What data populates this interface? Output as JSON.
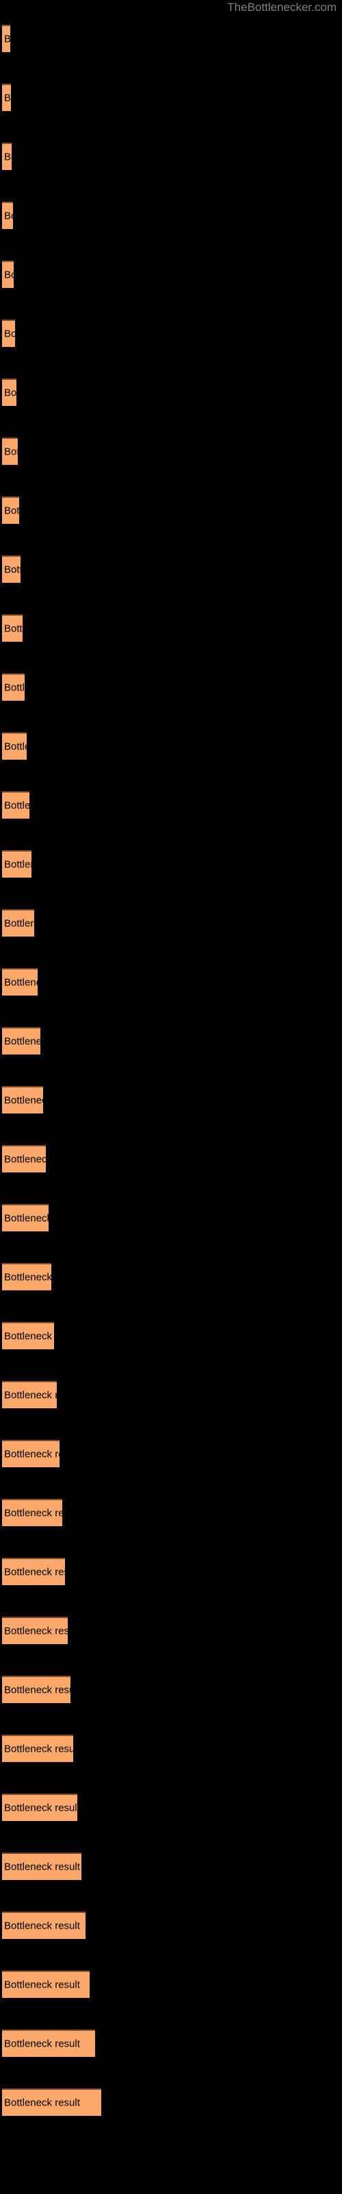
{
  "header": {
    "site_title": "TheBottlenecker.com"
  },
  "colors": {
    "background": "#000000",
    "bar_fill": "#FCA96B",
    "bar_edge": "#7a4a22",
    "bar_label_text": "#000000",
    "site_title_text": "#808080"
  },
  "chart_data": {
    "type": "bar",
    "orientation": "horizontal",
    "title": "TheBottlenecker.com",
    "xlabel": "",
    "ylabel": "",
    "grid": false,
    "legend": false,
    "xlim": [
      0,
      500
    ],
    "bar_label": "Bottleneck result",
    "categories": [
      "Bottleneck result",
      "Bottleneck result",
      "Bottleneck result",
      "Bottleneck result",
      "Bottleneck result",
      "Bottleneck result",
      "Bottleneck result",
      "Bottleneck result",
      "Bottleneck result",
      "Bottleneck result",
      "Bottleneck result",
      "Bottleneck result",
      "Bottleneck result",
      "Bottleneck result",
      "Bottleneck result",
      "Bottleneck result",
      "Bottleneck result",
      "Bottleneck result",
      "Bottleneck result",
      "Bottleneck result",
      "Bottleneck result",
      "Bottleneck result",
      "Bottleneck result",
      "Bottleneck result",
      "Bottleneck result",
      "Bottleneck result",
      "Bottleneck result",
      "Bottleneck result",
      "Bottleneck result",
      "Bottleneck result",
      "Bottleneck result",
      "Bottleneck result",
      "Bottleneck result",
      "Bottleneck result",
      "Bottleneck result",
      "Bottleneck result"
    ],
    "values": [
      12,
      13,
      14,
      16,
      17,
      19,
      21,
      23,
      25,
      27,
      30,
      33,
      36,
      40,
      43,
      47,
      52,
      56,
      60,
      64,
      68,
      72,
      76,
      80,
      84,
      88,
      92,
      96,
      100,
      104,
      110,
      116,
      122,
      128,
      136,
      145
    ],
    "bar_tops": [
      36,
      122,
      208,
      294,
      380,
      466,
      552,
      638,
      724,
      810,
      896,
      982,
      1068,
      1154,
      1240,
      1326,
      1412,
      1498,
      1584,
      1670,
      1756,
      1842,
      1928,
      2014,
      2100,
      2186,
      2272,
      2358,
      2444,
      2530,
      2616,
      2702,
      2788,
      2874,
      2960,
      3046
    ]
  }
}
